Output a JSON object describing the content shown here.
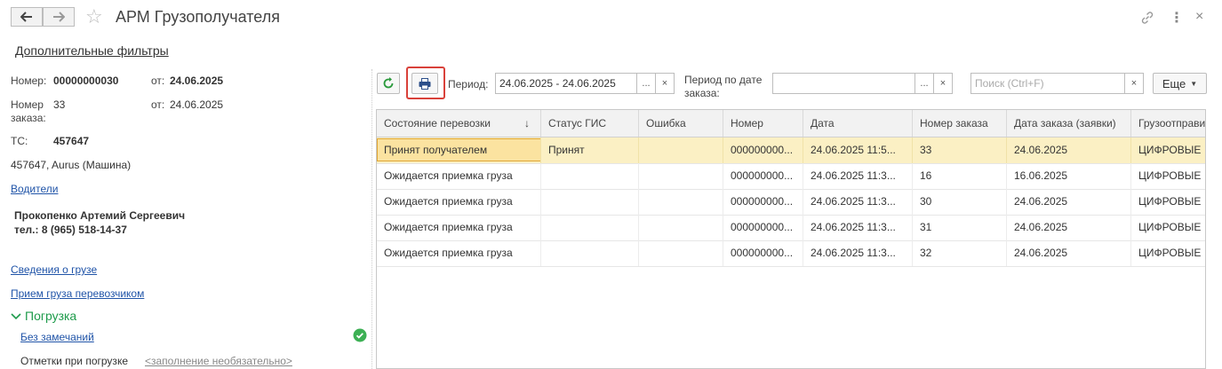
{
  "window": {
    "title": "АРМ Грузополучателя",
    "additional_filters": "Дополнительные фильтры"
  },
  "left": {
    "number_label": "Номер:",
    "number_value": "00000000030",
    "from_label": "от:",
    "from_value": "24.06.2025",
    "order_label_1": "Номер",
    "order_label_2": "заказа:",
    "order_value": "33",
    "order_from_label": "от:",
    "order_from_value": "24.06.2025",
    "ts_label": "ТС:",
    "ts_value": "457647",
    "vehicle": "457647, Aurus (Машина)",
    "drivers_link": "Водители",
    "driver_name": "Прокопенко Артемий Сергеевич",
    "driver_phone": "тел.: 8 (965) 518-14-37",
    "cargo_info_link": "Сведения о грузе",
    "carrier_accept_link": "Прием груза перевозчиком",
    "loading_section": "Погрузка",
    "no_remarks_link": "Без замечаний",
    "loading_marks_label": "Отметки при погрузке",
    "loading_marks_hint": "<заполнение необязательно>"
  },
  "toolbar": {
    "period_label": "Период:",
    "period_value": "24.06.2025 - 24.06.2025",
    "order_period_label_1": "Период по дате",
    "order_period_label_2": "заказа:",
    "order_period_value": "",
    "search_placeholder": "Поиск (Ctrl+F)",
    "more_label": "Еще",
    "ellipsis": "...",
    "clear": "×"
  },
  "table": {
    "columns": [
      "Состояние перевозки",
      "Статус ГИС",
      "Ошибка",
      "Номер",
      "Дата",
      "Номер заказа",
      "Дата заказа (заявки)",
      "Грузоотправи"
    ],
    "sort_indicator": "↓",
    "rows": [
      [
        "Принят получателем",
        "Принят",
        "",
        "000000000...",
        "24.06.2025 11:5...",
        "33",
        "24.06.2025",
        "ЦИФРОВЫЕ"
      ],
      [
        "Ожидается приемка груза",
        "",
        "",
        "000000000...",
        "24.06.2025 11:3...",
        "16",
        "16.06.2025",
        "ЦИФРОВЫЕ"
      ],
      [
        "Ожидается приемка груза",
        "",
        "",
        "000000000...",
        "24.06.2025 11:3...",
        "30",
        "24.06.2025",
        "ЦИФРОВЫЕ"
      ],
      [
        "Ожидается приемка груза",
        "",
        "",
        "000000000...",
        "24.06.2025 11:3...",
        "31",
        "24.06.2025",
        "ЦИФРОВЫЕ"
      ],
      [
        "Ожидается приемка груза",
        "",
        "",
        "000000000...",
        "24.06.2025 11:3...",
        "32",
        "24.06.2025",
        "ЦИФРОВЫЕ"
      ]
    ]
  },
  "colors": {
    "accent_green": "#1e9b4b",
    "link_blue": "#2054a8",
    "selected_row": "#fbf0c4",
    "highlight_border": "#d9413a"
  }
}
